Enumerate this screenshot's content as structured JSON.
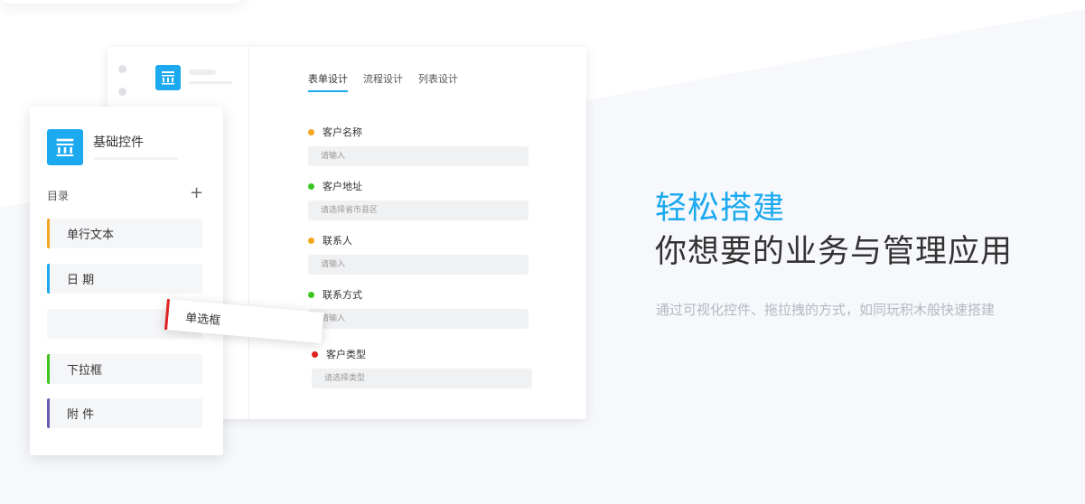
{
  "designer": {
    "tabs": [
      {
        "label": "表单设计",
        "active": true
      },
      {
        "label": "流程设计",
        "active": false
      },
      {
        "label": "列表设计",
        "active": false
      }
    ],
    "fields": [
      {
        "label": "客户名称",
        "placeholder": "请输入",
        "bullet_color": "#f5a623"
      },
      {
        "label": "客户地址",
        "placeholder": "请选择省市县区",
        "bullet_color": "#3cc51f"
      },
      {
        "label": "联系人",
        "placeholder": "请输入",
        "bullet_color": "#f5a623"
      },
      {
        "label": "联系方式",
        "placeholder": "请输入",
        "bullet_color": "#3cc51f"
      },
      {
        "label": "客户类型",
        "placeholder": "请选择类型",
        "bullet_color": "#e02020"
      }
    ]
  },
  "panel": {
    "title": "基础控件",
    "catalog_label": "目录",
    "add_icon": "+",
    "controls": [
      {
        "label": "单行文本",
        "color": "#f5a623"
      },
      {
        "label": "日 期",
        "color": "#1ba9f0"
      },
      {
        "label": "",
        "color": ""
      },
      {
        "label": "下拉框",
        "color": "#3cc51f"
      },
      {
        "label": "附 件",
        "color": "#6b5bb6"
      }
    ]
  },
  "drag_item": {
    "label": "单选框",
    "color": "#e02020"
  },
  "hero": {
    "headline_accent": "轻松搭建",
    "headline_main": "你想要的业务与管理应用",
    "description": "通过可视化控件、拖拉拽的方式，如同玩积木般快速搭建"
  },
  "colors": {
    "accent": "#1ba9f0"
  }
}
